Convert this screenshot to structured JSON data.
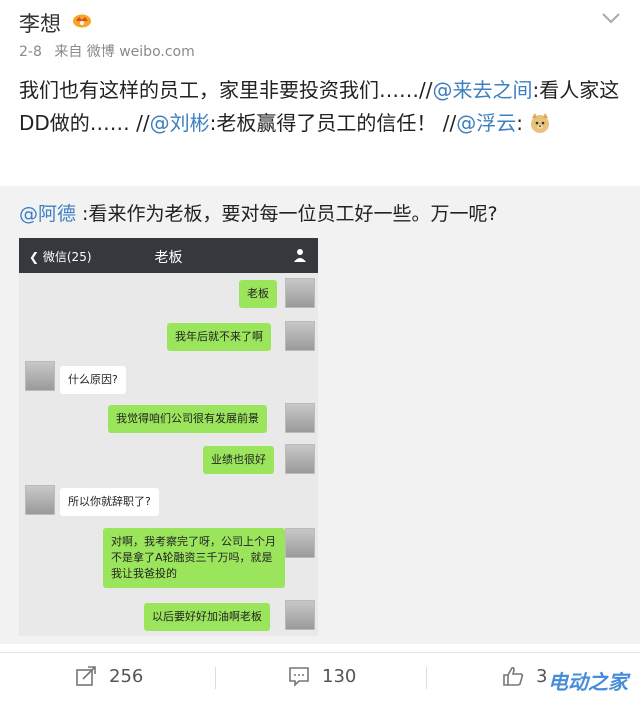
{
  "post": {
    "username": "李想",
    "date": "2-8",
    "source": "来自 微博 weibo.com",
    "text_1": "我们也有这样的员工，家里非要投资我们……//",
    "mention_1": "@来去之间",
    "text_2": ":看人家这DD做的…… //",
    "mention_2": "@刘彬",
    "text_3": ":老板赢得了员工的信任！ //",
    "mention_3": "@浮云",
    "text_4": ":"
  },
  "repost": {
    "mention": "@阿德",
    "text": " :看来作为老板，要对每一位员工好一些。万一呢?"
  },
  "chat": {
    "back_label": "微信(25)",
    "title": "老板",
    "messages": [
      {
        "side": "out",
        "text": "老板"
      },
      {
        "side": "out",
        "text": "我年后就不来了啊"
      },
      {
        "side": "in",
        "text": "什么原因?"
      },
      {
        "side": "out",
        "text": "我觉得咱们公司很有发展前景"
      },
      {
        "side": "out",
        "text": "业绩也很好"
      },
      {
        "side": "in",
        "text": "所以你就辞职了?"
      },
      {
        "side": "out",
        "text": "对啊，我考察完了呀，公司上个月不是拿了A轮融资三千万吗，就是我让我爸投的"
      },
      {
        "side": "out",
        "text": "以后要好好加油啊老板"
      }
    ]
  },
  "footer": {
    "repost_count": "256",
    "comment_count": "130",
    "like_count": "3",
    "watermark": "电动之家"
  }
}
